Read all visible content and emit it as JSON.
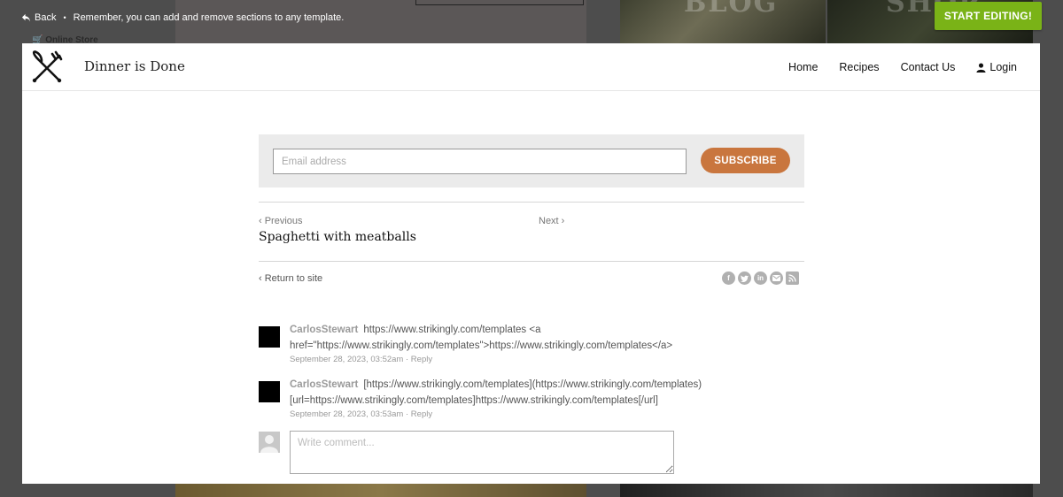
{
  "overlay": {
    "back_label": "Back",
    "separator": "•",
    "notice": "Remember, you can add and remove sections to any template.",
    "start_editing_label": "START EDITING!",
    "start_editing_color": "#7ab317",
    "background_online_store": "Online Store",
    "background_words": [
      "BLOG",
      "SHOP"
    ]
  },
  "site": {
    "name": "Dinner is Done",
    "logo_icon": "fork-knife-cross-icon",
    "nav": {
      "home": "Home",
      "recipes": "Recipes",
      "contact": "Contact Us",
      "login": "Login"
    }
  },
  "subscribe": {
    "email_placeholder": "Email address",
    "button_label": "SUBSCRIBE",
    "button_color": "#c9763e"
  },
  "post_nav": {
    "previous_label": "‹ Previous",
    "next_label": "Next ›",
    "previous_title": "Spaghetti with meatballs"
  },
  "return_label": "‹ Return to site",
  "share_icons": [
    "facebook-icon",
    "twitter-icon",
    "linkedin-icon",
    "email-icon",
    "rss-icon"
  ],
  "comments": [
    {
      "author": "CarlosStewart",
      "text": "https://www.strikingly.com/templates <a href=\"https://www.strikingly.com/templates\">https://www.strikingly.com/templates</a>",
      "date": "September 28, 2023, 03:52am",
      "reply": "Reply"
    },
    {
      "author": "CarlosStewart",
      "text": "[https://www.strikingly.com/templates](https://www.strikingly.com/templates) [url=https://www.strikingly.com/templates]https://www.strikingly.com/templates[/url]",
      "date": "September 28, 2023, 03:53am",
      "reply": "Reply"
    }
  ],
  "new_comment": {
    "placeholder": "Write comment..."
  },
  "meta_separator": " · "
}
